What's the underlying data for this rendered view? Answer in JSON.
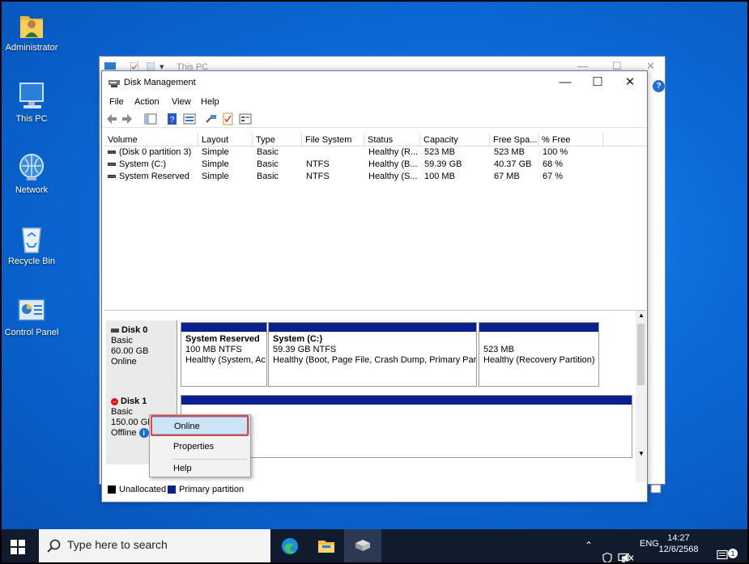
{
  "desktop": {
    "icons": [
      {
        "label": "Administrator",
        "icon": "user-folder-icon"
      },
      {
        "label": "This PC",
        "icon": "computer-icon"
      },
      {
        "label": "Network",
        "icon": "network-icon"
      },
      {
        "label": "Recycle Bin",
        "icon": "recycle-bin-icon"
      },
      {
        "label": "Control Panel",
        "icon": "control-panel-icon"
      }
    ]
  },
  "background_window": {
    "title": "This PC"
  },
  "window": {
    "title": "Disk Management",
    "menu": [
      "File",
      "Action",
      "View",
      "Help"
    ],
    "columns": [
      "Volume",
      "Layout",
      "Type",
      "File System",
      "Status",
      "Capacity",
      "Free Spa...",
      "% Free"
    ],
    "volumes": [
      {
        "volume": "(Disk 0 partition 3)",
        "layout": "Simple",
        "type": "Basic",
        "fs": "",
        "status": "Healthy (R...",
        "capacity": "523 MB",
        "free": "523 MB",
        "pct": "100 %"
      },
      {
        "volume": "System (C:)",
        "layout": "Simple",
        "type": "Basic",
        "fs": "NTFS",
        "status": "Healthy (B...",
        "capacity": "59.39 GB",
        "free": "40.37 GB",
        "pct": "68 %"
      },
      {
        "volume": "System Reserved",
        "layout": "Simple",
        "type": "Basic",
        "fs": "NTFS",
        "status": "Healthy (S...",
        "capacity": "100 MB",
        "free": "67 MB",
        "pct": "67 %"
      }
    ],
    "disks": [
      {
        "name": "Disk 0",
        "kind": "Basic",
        "size": "60.00 GB",
        "state": "Online",
        "partitions": [
          {
            "name": "System Reserved",
            "size": "100 MB NTFS",
            "status": "Healthy (System, Ac"
          },
          {
            "name": "System  (C:)",
            "size": "59.39 GB NTFS",
            "status": "Healthy (Boot, Page File, Crash Dump, Primary Partit"
          },
          {
            "name": "",
            "size": "523 MB",
            "status": "Healthy (Recovery Partition)"
          }
        ]
      },
      {
        "name": "Disk 1",
        "kind": "Basic",
        "size": "150.00 GB",
        "state": "Offline"
      }
    ],
    "legend": {
      "unallocated": "Unallocated",
      "primary": "Primary partition",
      "colors": {
        "unallocated": "#000000",
        "primary": "#0b1f8f"
      }
    }
  },
  "context_menu": {
    "items": [
      "Online",
      "Properties",
      "Help"
    ],
    "highlighted": "Online"
  },
  "taskbar": {
    "search_placeholder": "Type here to search",
    "language": "ENG",
    "time": "14:27",
    "date": "12/6/2568",
    "notification_count": "1"
  }
}
